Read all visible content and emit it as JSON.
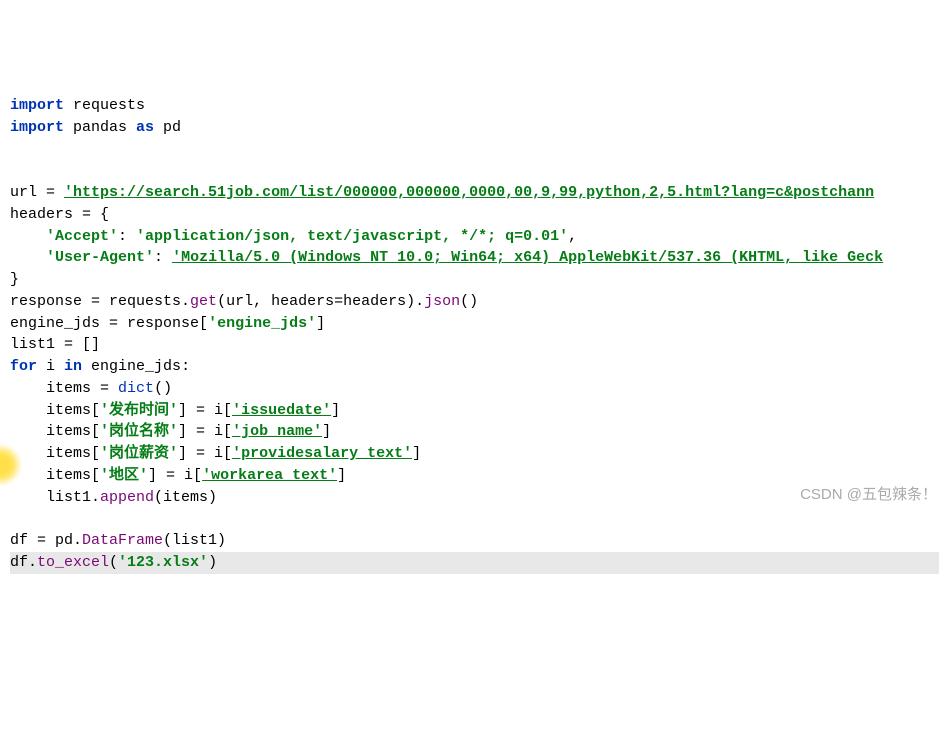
{
  "code": {
    "l1_kw1": "import",
    "l1_mod": " requests",
    "l2_kw1": "import",
    "l2_mod": " pandas ",
    "l2_kw2": "as",
    "l2_alias": " pd",
    "l5_var": "url ",
    "l5_op": "= ",
    "l5_str": "'https://search.51job.com/list/000000,000000,0000,00,9,99,python,2,5.html?lang=c&postchann",
    "l6_var": "headers ",
    "l6_op": "= {",
    "l7_indent": "    ",
    "l7_key": "'Accept'",
    "l7_colon": ": ",
    "l7_val": "'application/json, text/javascript, */*; q=0.01'",
    "l7_comma": ",",
    "l8_indent": "    ",
    "l8_key": "'User-Agent'",
    "l8_colon": ": ",
    "l8_val": "'Mozilla/5.0 (Windows NT 10.0; Win64; x64) AppleWebKit/537.36 (KHTML, like Geck",
    "l9_brace": "}",
    "l10_var": "response ",
    "l10_op": "= requests.",
    "l10_get": "get",
    "l10_args": "(url, ",
    "l10_kwarg": "headers",
    "l10_eq": "=headers).",
    "l10_json": "json",
    "l10_paren": "()",
    "l11_var": "engine_jds ",
    "l11_op": "= response[",
    "l11_key": "'engine_jds'",
    "l11_close": "]",
    "l12_var": "list1 ",
    "l12_op": "= []",
    "l13_kw": "for",
    "l13_i": " i ",
    "l13_in": "in",
    "l13_iter": " engine_jds:",
    "l14_indent": "    ",
    "l14_var": "items ",
    "l14_op": "= ",
    "l14_dict": "dict",
    "l14_paren": "()",
    "l15_indent": "    ",
    "l15_var": "items[",
    "l15_key": "'发布时间'",
    "l15_mid": "] = i[",
    "l15_val": "'issuedate'",
    "l15_close": "]",
    "l16_indent": "    ",
    "l16_var": "items[",
    "l16_key": "'岗位名称'",
    "l16_mid": "] = i[",
    "l16_val": "'job_name'",
    "l16_close": "]",
    "l17_indent": "    ",
    "l17_var": "items[",
    "l17_key": "'岗位薪资'",
    "l17_mid": "] = i[",
    "l17_val": "'providesalary_text'",
    "l17_close": "]",
    "l18_indent": "    ",
    "l18_var": "items[",
    "l18_key": "'地区'",
    "l18_mid": "] = i[",
    "l18_val": "'workarea_text'",
    "l18_close": "]",
    "l19_indent": "    ",
    "l19_var": "list1.",
    "l19_method": "append",
    "l19_args": "(items)",
    "l21_var": "df ",
    "l21_op": "= pd.",
    "l21_method": "DataFrame",
    "l21_args": "(list1)",
    "l22_var": "df.",
    "l22_method": "to_excel",
    "l22_open": "(",
    "l22_str": "'123.xlsx'",
    "l22_close": ")"
  },
  "watermark": "CSDN @五包辣条！"
}
